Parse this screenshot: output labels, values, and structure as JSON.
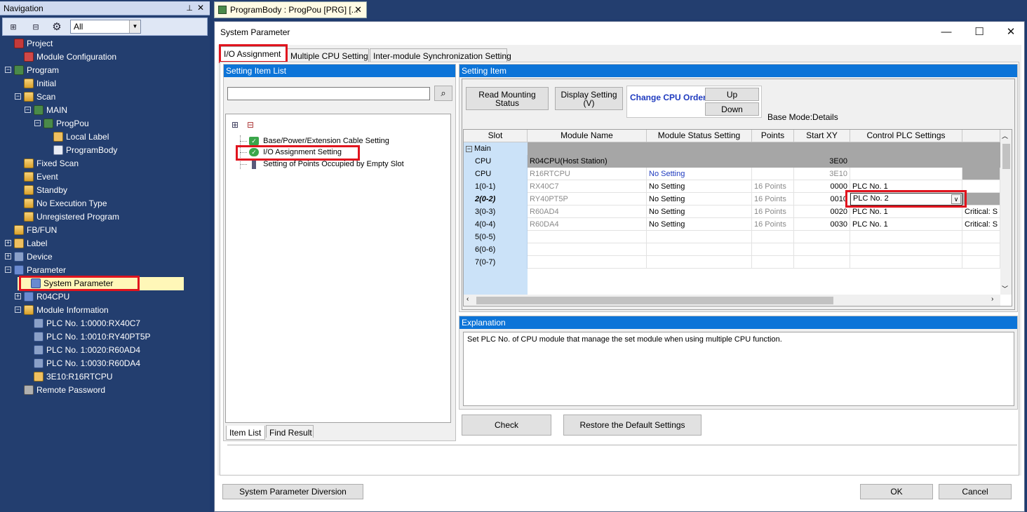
{
  "nav": {
    "title": "Navigation",
    "pin": "ᵍ",
    "close": "✕",
    "filter_value": "All",
    "tree": [
      {
        "label": "Project",
        "icon": "project-icon"
      },
      {
        "label": "Module Configuration",
        "icon": "module-config-icon"
      },
      {
        "label": "Program",
        "icon": "program-folder-icon"
      },
      {
        "label": "Initial",
        "icon": "folder-icon"
      },
      {
        "label": "Scan",
        "icon": "folder-icon"
      },
      {
        "label": "MAIN",
        "icon": "program-icon"
      },
      {
        "label": "ProgPou",
        "icon": "pou-icon"
      },
      {
        "label": "Local Label",
        "icon": "label-icon"
      },
      {
        "label": "ProgramBody",
        "icon": "program-body-icon"
      },
      {
        "label": "Fixed Scan",
        "icon": "folder-icon"
      },
      {
        "label": "Event",
        "icon": "folder-icon"
      },
      {
        "label": "Standby",
        "icon": "folder-icon"
      },
      {
        "label": "No Execution Type",
        "icon": "folder-icon"
      },
      {
        "label": "Unregistered Program",
        "icon": "folder-icon"
      },
      {
        "label": "FB/FUN",
        "icon": "fbfun-icon"
      },
      {
        "label": "Label",
        "icon": "label-folder-icon"
      },
      {
        "label": "Device",
        "icon": "device-icon"
      },
      {
        "label": "Parameter",
        "icon": "parameter-icon"
      },
      {
        "label": "System Parameter",
        "icon": "system-parameter-icon"
      },
      {
        "label": "R04CPU",
        "icon": "cpu-icon"
      },
      {
        "label": "Module Information",
        "icon": "module-info-icon"
      },
      {
        "label": "PLC No. 1:0000:RX40C7",
        "icon": "module-icon"
      },
      {
        "label": "PLC No. 1:0010:RY40PT5P",
        "icon": "module-icon"
      },
      {
        "label": "PLC No. 1:0020:R60AD4",
        "icon": "module-icon"
      },
      {
        "label": "PLC No. 1:0030:R60DA4",
        "icon": "module-icon"
      },
      {
        "label": "3E10:R16RTCPU",
        "icon": "module-icon"
      },
      {
        "label": "Remote Password",
        "icon": "lock-icon"
      }
    ]
  },
  "doctab": {
    "label": "ProgramBody : ProgPou [PRG] [...",
    "close": "✕"
  },
  "dialog": {
    "title": "System Parameter",
    "min": "—",
    "max": "☐",
    "close": "✕",
    "tabs": [
      "I/O Assignment",
      "Multiple CPU Setting",
      "Inter-module Synchronization Setting"
    ],
    "item_list": {
      "header": "Setting Item List",
      "search_value": "",
      "items": [
        "Base/Power/Extension Cable Setting",
        "I/O Assignment Setting",
        "Setting of Points Occupied by Empty Slot"
      ],
      "bottom_tabs": [
        "Item List",
        "Find Result"
      ]
    },
    "setting_item": {
      "header": "Setting Item",
      "read_mounting": "Read Mounting Status",
      "display_setting": "Display Setting (V)",
      "change_cpu_order": "Change CPU Order",
      "up": "Up",
      "down": "Down",
      "base_mode": "Base Mode:Details",
      "columns": [
        "Slot",
        "Module Name",
        "Module Status Setting",
        "Points",
        "Start XY",
        "Control PLC Settings"
      ],
      "group": "Main",
      "rows": [
        {
          "slot": "CPU",
          "name": "R04CPU(Host Station)",
          "status": "",
          "points": "",
          "start": "3E00",
          "plc": "",
          "extra": ""
        },
        {
          "slot": "CPU",
          "name": "R16RTCPU",
          "status": "No Setting",
          "points": "",
          "start": "3E10",
          "plc": "",
          "extra": ""
        },
        {
          "slot": "1(0-1)",
          "name": "RX40C7",
          "status": "No Setting",
          "points": "16 Points",
          "start": "0000",
          "plc": "PLC No. 1",
          "extra": ""
        },
        {
          "slot": "2(0-2)",
          "name": "RY40PT5P",
          "status": "No Setting",
          "points": "16 Points",
          "start": "0010",
          "plc": "PLC No. 2",
          "extra": ""
        },
        {
          "slot": "3(0-3)",
          "name": "R60AD4",
          "status": "No Setting",
          "points": "16 Points",
          "start": "0020",
          "plc": "PLC No. 1",
          "extra": "Critical: S"
        },
        {
          "slot": "4(0-4)",
          "name": "R60DA4",
          "status": "No Setting",
          "points": "16 Points",
          "start": "0030",
          "plc": "PLC No. 1",
          "extra": "Critical: S"
        },
        {
          "slot": "5(0-5)",
          "name": "",
          "status": "",
          "points": "",
          "start": "",
          "plc": "",
          "extra": ""
        },
        {
          "slot": "6(0-6)",
          "name": "",
          "status": "",
          "points": "",
          "start": "",
          "plc": "",
          "extra": ""
        },
        {
          "slot": "7(0-7)",
          "name": "",
          "status": "",
          "points": "",
          "start": "",
          "plc": "",
          "extra": ""
        }
      ]
    },
    "explanation": {
      "header": "Explanation",
      "text": "Set PLC No. of CPU module that manage the set module when using multiple CPU function."
    },
    "check": "Check",
    "restore": "Restore the Default Settings",
    "diversion": "System Parameter Diversion",
    "ok": "OK",
    "cancel": "Cancel"
  }
}
